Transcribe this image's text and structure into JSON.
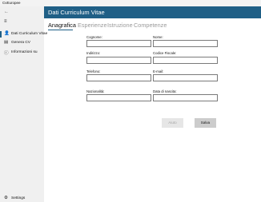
{
  "window": {
    "title": "CvEuropee"
  },
  "sidebar": {
    "back_icon": "back-arrow-icon",
    "menu_icon": "hamburger-icon",
    "items": [
      {
        "label": "Dati Curriculum Vitae",
        "icon": "person-icon",
        "active": true
      },
      {
        "label": "Genera CV",
        "icon": "document-icon",
        "active": false
      },
      {
        "label": "Informazioni su",
        "icon": "info-icon",
        "active": false
      }
    ],
    "settings_label": "Settings"
  },
  "header": {
    "title": "Dati Curriculum Vitae",
    "color": "#1f5f86"
  },
  "tabs": [
    "Anagrafica",
    "Esperienze",
    "Istruzione",
    "Competenze"
  ],
  "form": {
    "fields": [
      {
        "label": "Cognome:",
        "value": ""
      },
      {
        "label": "Nome:",
        "value": ""
      },
      {
        "label": "Indirizzo:",
        "value": ""
      },
      {
        "label": "Codice Fiscale:",
        "value": ""
      },
      {
        "label": "Telefono:",
        "value": ""
      },
      {
        "label": "E-mail:",
        "value": ""
      },
      {
        "label": "Nazionalità:",
        "value": ""
      },
      {
        "label": "Data di nascita:",
        "value": ""
      }
    ]
  },
  "buttons": {
    "aiuto": "Aiuto",
    "salva": "Salva"
  }
}
